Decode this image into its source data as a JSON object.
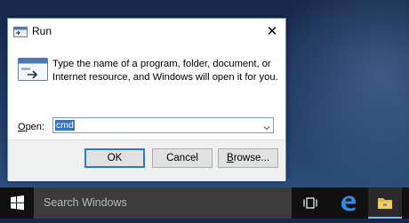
{
  "dialog": {
    "title": "Run",
    "close_glyph": "✕",
    "description": "Type the name of a program, folder, document, or Internet resource, and Windows will open it for you.",
    "open_label_prefix": "O",
    "open_label_rest": "pen:",
    "open_value": "cmd",
    "buttons": {
      "ok": "OK",
      "cancel": "Cancel",
      "browse_prefix": "B",
      "browse_rest": "rowse..."
    }
  },
  "taskbar": {
    "search_placeholder": "Search Windows",
    "icons": [
      "windows-logo-icon",
      "task-view-icon",
      "edge-icon",
      "file-explorer-icon"
    ]
  },
  "colors": {
    "accent": "#3373c4",
    "taskbar": "#101010",
    "search_box": "#3b3b3b"
  }
}
